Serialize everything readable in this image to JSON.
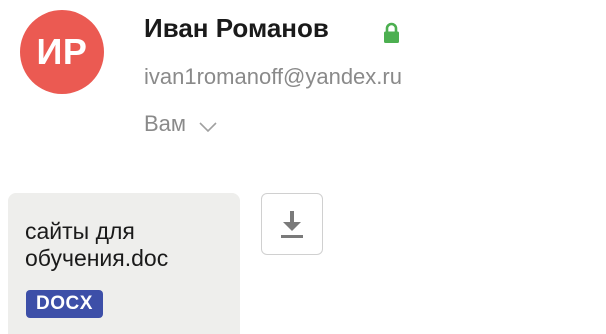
{
  "sender": {
    "initials": "ИР",
    "name": "Иван Романов",
    "email": "ivan1romanoff@yandex.ru",
    "avatar_color": "#eb5a52",
    "verified_icon": "lock-icon",
    "verified_color": "#4caf50"
  },
  "recipient": {
    "label": "Вам",
    "icon": "chevron-down-icon"
  },
  "attachment": {
    "filename": "сайты для обучения.doc",
    "type_badge": "DOCX",
    "badge_color": "#3d4fa8",
    "download_icon": "download-icon"
  }
}
